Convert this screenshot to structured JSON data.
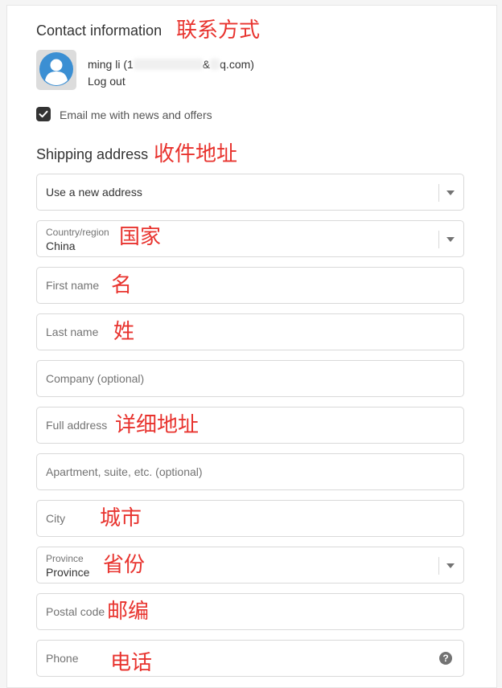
{
  "contact": {
    "title": "Contact information",
    "title_cn": "联系方式",
    "account_name": "ming li (1",
    "account_email_masked": "&",
    "account_email_end": "q.com)",
    "logout_label": "Log out",
    "newsletter_label": "Email me with news and offers",
    "newsletter_checked": true
  },
  "shipping": {
    "title": "Shipping address",
    "title_cn": "收件地址",
    "address_select": {
      "value": "Use a new address"
    },
    "country": {
      "label": "Country/region",
      "value": "China",
      "annotation": "国家"
    },
    "first_name": {
      "placeholder": "First name",
      "annotation": "名"
    },
    "last_name": {
      "placeholder": "Last name",
      "annotation": "姓"
    },
    "company": {
      "placeholder": "Company (optional)"
    },
    "address": {
      "placeholder": "Full address",
      "annotation": "详细地址"
    },
    "apartment": {
      "placeholder": "Apartment, suite, etc. (optional)"
    },
    "city": {
      "placeholder": "City",
      "annotation": "城市"
    },
    "province": {
      "label": "Province",
      "value": "Province",
      "annotation": "省份"
    },
    "postal_code": {
      "placeholder": "Postal code",
      "annotation": "邮编"
    },
    "phone": {
      "placeholder": "Phone",
      "annotation": "电话",
      "help_glyph": "?"
    }
  },
  "colors": {
    "annotation_red": "#e8332e",
    "checkbox_dark": "#333333",
    "border_gray": "#d9d9d9",
    "placeholder_gray": "#737373",
    "avatar_blue": "#3b8fd3"
  },
  "icons": {
    "avatar": "user-avatar-icon",
    "checkbox": "checkmark-icon",
    "select_caret": "chevron-down-icon",
    "help": "question-circle-icon"
  }
}
